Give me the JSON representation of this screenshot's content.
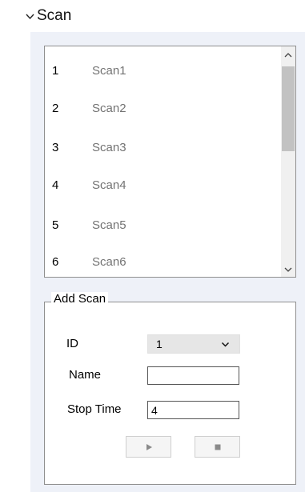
{
  "section": {
    "title": "Scan"
  },
  "scan_list": {
    "items": [
      {
        "id": "1",
        "name": "Scan1"
      },
      {
        "id": "2",
        "name": "Scan2"
      },
      {
        "id": "3",
        "name": "Scan3"
      },
      {
        "id": "4",
        "name": "Scan4"
      },
      {
        "id": "5",
        "name": "Scan5"
      },
      {
        "id": "6",
        "name": "Scan6"
      }
    ],
    "scroll_up_icon": "chevron-up-icon",
    "scroll_down_icon": "chevron-down-icon"
  },
  "add_scan": {
    "legend": "Add Scan",
    "id_label": "ID",
    "id_value": "1",
    "name_label": "Name",
    "name_value": "",
    "stop_time_label": "Stop Time",
    "stop_time_value": "4",
    "play_icon": "play-icon",
    "stop_icon": "stop-icon"
  }
}
